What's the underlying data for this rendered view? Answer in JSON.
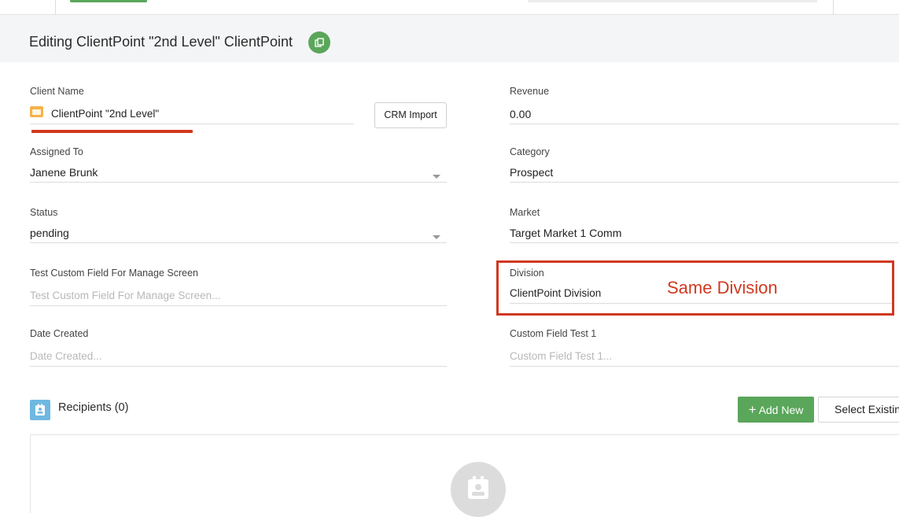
{
  "header": {
    "title": "Editing ClientPoint \"2nd Level\" ClientPoint"
  },
  "form": {
    "client_name": {
      "label": "Client Name",
      "value": "ClientPoint \"2nd Level\""
    },
    "crm_import_label": "CRM Import",
    "assigned_to": {
      "label": "Assigned To",
      "value": "Janene Brunk"
    },
    "status": {
      "label": "Status",
      "value": "pending"
    },
    "test_custom": {
      "label": "Test Custom Field For Manage Screen",
      "placeholder": "Test Custom Field For Manage Screen..."
    },
    "date_created": {
      "label": "Date Created",
      "placeholder": "Date Created..."
    },
    "revenue": {
      "label": "Revenue",
      "value": "0.00"
    },
    "category": {
      "label": "Category",
      "value": "Prospect"
    },
    "market": {
      "label": "Market",
      "value": "Target Market 1 Comm"
    },
    "division": {
      "label": "Division",
      "value": "ClientPoint Division"
    },
    "custom_field_1": {
      "label": "Custom Field Test 1",
      "placeholder": "Custom Field Test 1..."
    }
  },
  "annotation": {
    "text": "Same Division",
    "color": "#d0391f"
  },
  "recipients": {
    "title": "Recipients (0)",
    "add_new_label": "Add New",
    "select_existing_label": "Select Existing"
  },
  "colors": {
    "accent_green": "#5aa65a",
    "annotation_red": "#d0391f",
    "folder_orange": "#f5b24a",
    "recipient_blue": "#6fb8e0"
  },
  "icons": [
    "copy-icon",
    "folder-icon",
    "chevron-down-icon",
    "plus-icon",
    "contact-card-icon"
  ]
}
